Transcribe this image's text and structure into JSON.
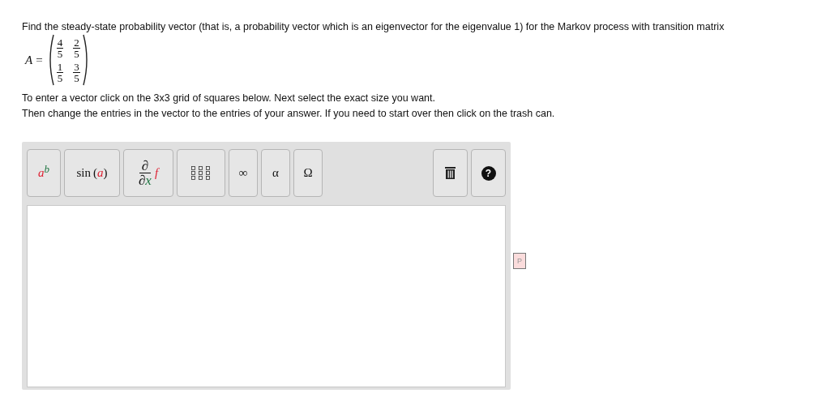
{
  "prompt": "Find the steady-state probability vector (that is, a probability vector which is an eigenvector for the eigenvalue 1) for the Markov process with transition matrix",
  "matrix": {
    "label": "A",
    "equals": "=",
    "rows": [
      [
        {
          "num": "4",
          "den": "5"
        },
        {
          "num": "2",
          "den": "5"
        }
      ],
      [
        {
          "num": "1",
          "den": "5"
        },
        {
          "num": "3",
          "den": "5"
        }
      ]
    ]
  },
  "instructions": [
    "To enter a vector click on the 3x3 grid of squares below. Next select the exact size you want.",
    "Then change the entries in the vector to the entries of your answer. If you need to start over then click on the trash can."
  ],
  "toolbar": {
    "left": [
      {
        "kind": "power",
        "base": "a",
        "exponent": "b"
      },
      {
        "kind": "function",
        "name": "sin",
        "open": "(",
        "arg": "a",
        "close": ")"
      },
      {
        "kind": "derivative",
        "numerator": "∂",
        "denominator": "∂",
        "variable": "x",
        "func": "f"
      },
      {
        "kind": "matrix"
      },
      {
        "kind": "symbol",
        "label": "∞"
      },
      {
        "kind": "symbol",
        "label": "α"
      },
      {
        "kind": "symbol",
        "label": "Ω"
      }
    ],
    "right": [
      {
        "kind": "trash"
      },
      {
        "kind": "help",
        "label": "?"
      }
    ]
  },
  "side_icon": {
    "letter": "P"
  }
}
